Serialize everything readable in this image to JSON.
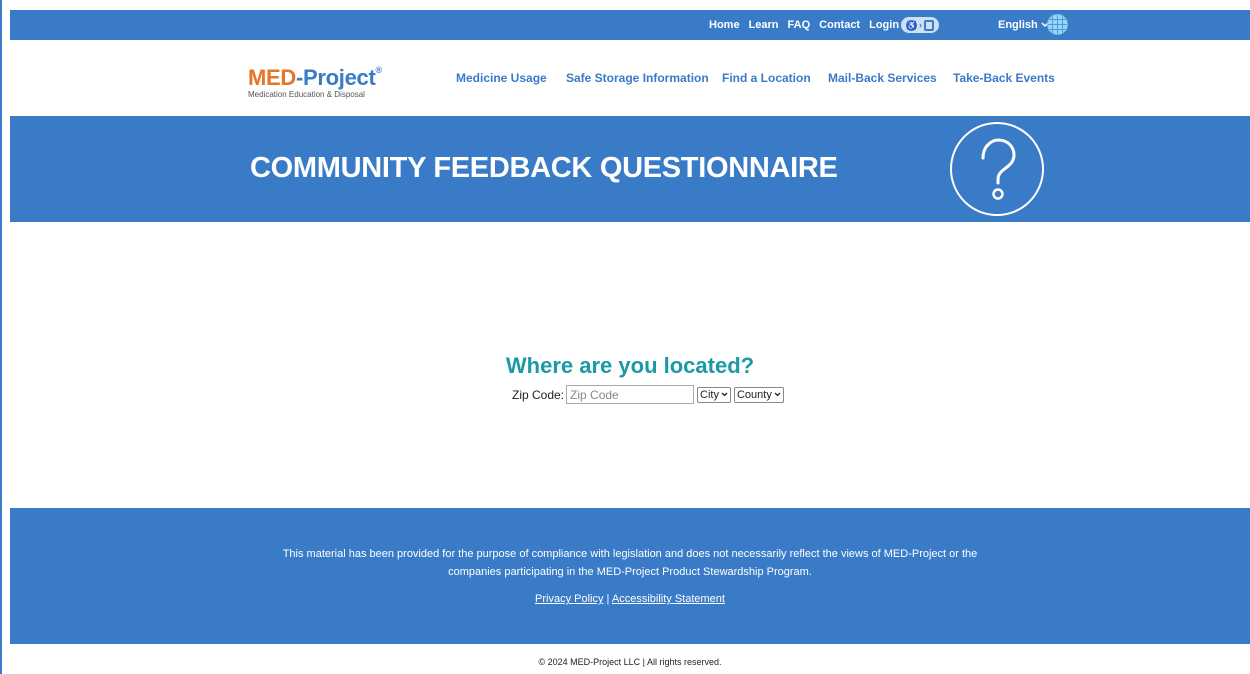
{
  "topbar": {
    "links": [
      "Home",
      "Learn",
      "FAQ",
      "Contact",
      "Login"
    ],
    "language": "English"
  },
  "logo": {
    "brand_part1": "MED",
    "brand_part2": "-Project",
    "registered": "®",
    "tagline": "Medication Education & Disposal"
  },
  "nav": {
    "items": [
      "Medicine Usage",
      "Safe Storage Information",
      "Find a Location",
      "Mail-Back Services",
      "Take-Back Events"
    ]
  },
  "hero": {
    "title": "COMMUNITY FEEDBACK QUESTIONNAIRE",
    "icon": "question-mark-icon"
  },
  "location_form": {
    "heading": "Where are you located?",
    "zip_label": "Zip Code:",
    "zip_placeholder": "Zip Code",
    "zip_value": "",
    "city_select": "City",
    "county_select": "County"
  },
  "footer": {
    "disclaimer_line1": "This material has been provided for the purpose of compliance with legislation and does not necessarily reflect the views of MED-Project or the",
    "disclaimer_line2": "companies participating in the MED-Project Product Stewardship Program.",
    "privacy_link": "Privacy Policy",
    "separator": "|",
    "accessibility_link": "Accessibility Statement",
    "copyright": "© 2024 MED-Project LLC | All rights reserved."
  },
  "colors": {
    "primary_blue": "#3a7bc8",
    "orange": "#e8742a",
    "teal": "#1a9aa5"
  }
}
